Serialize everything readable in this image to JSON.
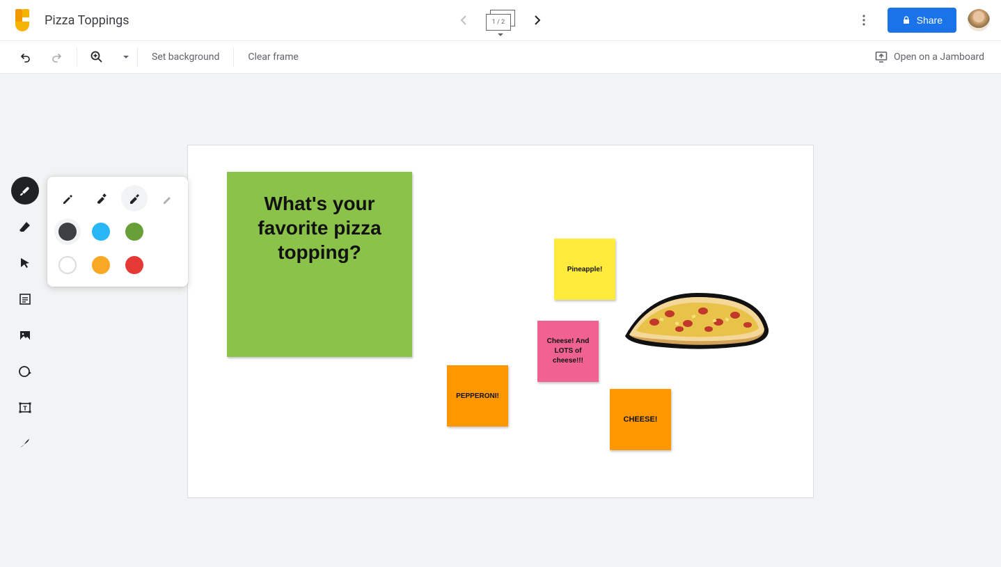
{
  "header": {
    "doc_title": "Pizza Toppings",
    "frame_indicator": "1 / 2",
    "share_label": "Share"
  },
  "toolbar": {
    "set_background_label": "Set background",
    "clear_frame_label": "Clear frame",
    "open_jamboard_label": "Open on a Jamboard"
  },
  "side_tools": [
    {
      "name": "pen",
      "active": true
    },
    {
      "name": "eraser",
      "active": false
    },
    {
      "name": "select",
      "active": false
    },
    {
      "name": "sticky-note",
      "active": false
    },
    {
      "name": "image",
      "active": false
    },
    {
      "name": "circle",
      "active": false
    },
    {
      "name": "text-box",
      "active": false
    },
    {
      "name": "laser",
      "active": false
    }
  ],
  "pen_panel": {
    "pen_types": [
      {
        "name": "pen",
        "selected": false,
        "light": false
      },
      {
        "name": "marker",
        "selected": false,
        "light": false
      },
      {
        "name": "highlighter",
        "selected": true,
        "light": false
      },
      {
        "name": "brush",
        "selected": false,
        "light": true
      }
    ],
    "colors_row1": [
      {
        "name": "black",
        "hex": "#3c4043",
        "selected": true
      },
      {
        "name": "blue",
        "hex": "#29b6f6",
        "selected": false
      },
      {
        "name": "green",
        "hex": "#689f38",
        "selected": false
      }
    ],
    "colors_row2": [
      {
        "name": "white",
        "hex": "#ffffff",
        "selected": false,
        "outline": true
      },
      {
        "name": "yellow",
        "hex": "#f9a825",
        "selected": false
      },
      {
        "name": "red",
        "hex": "#e53935",
        "selected": false
      }
    ]
  },
  "canvas": {
    "big_note_text": "What's your favorite pizza topping?",
    "notes": {
      "pineapple": "Pineapple!",
      "cheese_lots": "Cheese! And LOTS of cheese!!!",
      "pepperoni": "PEPPERONI!",
      "cheese": "CHEESE!"
    }
  }
}
